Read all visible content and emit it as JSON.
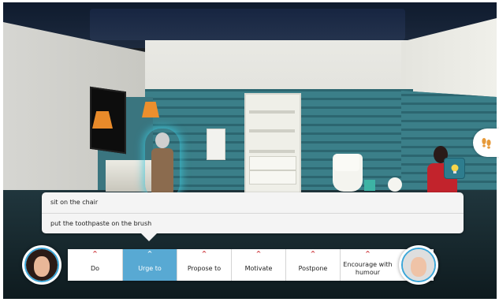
{
  "menu": {
    "items": [
      {
        "label": "sit on the chair"
      },
      {
        "label": "put the toothpaste on the brush"
      }
    ]
  },
  "action_bar": {
    "chevron": "^",
    "actions": [
      {
        "label": "Do",
        "active": false
      },
      {
        "label": "Urge to",
        "active": true
      },
      {
        "label": "Propose to",
        "active": false
      },
      {
        "label": "Motivate",
        "active": false
      },
      {
        "label": "Postpone",
        "active": false
      },
      {
        "label": "Encourage with humour",
        "active": false
      }
    ]
  },
  "icons": {
    "walk": "footprints-icon",
    "hint": "lightbulb-icon"
  },
  "colors": {
    "accent": "#58a9d3",
    "chevron": "#c8262b",
    "hint_button": "#2e7d8e",
    "avatar_ring": "#3ba6d8"
  }
}
